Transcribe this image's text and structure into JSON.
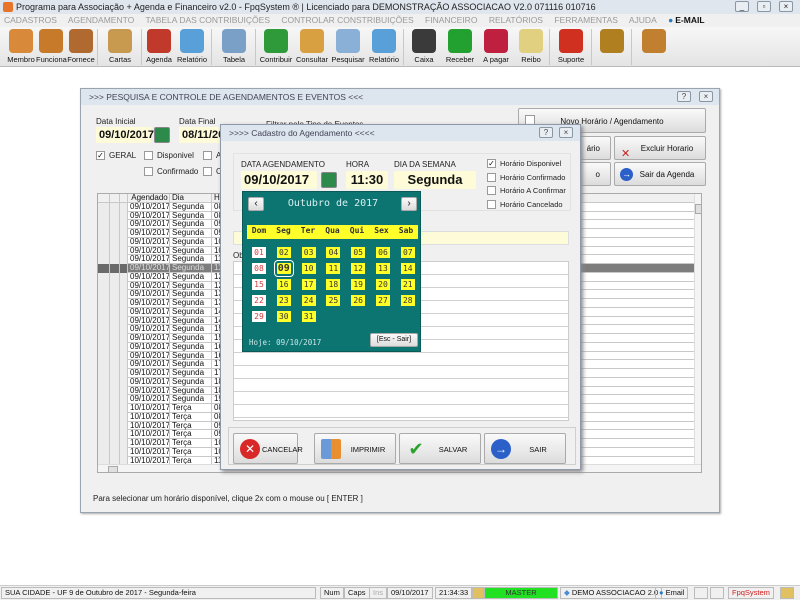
{
  "app": {
    "title": "Programa para Associação + Agenda e Financeiro v2.0 - FpqSystem ® | Licenciado para  DEMONSTRAÇÃO ASSOCIACAO V2.0 071116 010716"
  },
  "menu": [
    "CADASTROS",
    "AGENDAMENTO",
    "TABELA DAS CONTRIBUIÇÕES",
    "CONTROLAR CONSTRIBUIÇÕES",
    "FINANCEIRO",
    "RELATÓRIOS",
    "FERRAMENTAS",
    "AJUDA"
  ],
  "menu_email": "E-MAIL",
  "toolbar": [
    {
      "label": "Membro",
      "icon": "members-icon",
      "color": "#d88a3a"
    },
    {
      "label": "Funciona",
      "icon": "employee-icon",
      "color": "#c77a2a"
    },
    {
      "label": "Fornece",
      "icon": "supplier-icon",
      "color": "#b06a30"
    },
    {
      "label": "Cartas",
      "icon": "scroll-icon",
      "color": "#c89a50"
    },
    {
      "label": "Agenda",
      "icon": "calendar-icon",
      "color": "#c0392b"
    },
    {
      "label": "Relatório",
      "icon": "report-icon",
      "color": "#5aa0d8"
    },
    {
      "label": "Tabela",
      "icon": "table-icon",
      "color": "#7aa0c8"
    },
    {
      "label": "Contribuir",
      "icon": "dollar-icon",
      "color": "#2e9a3a"
    },
    {
      "label": "Consultar",
      "icon": "folder-icon",
      "color": "#d8a040"
    },
    {
      "label": "Pesquisar",
      "icon": "search-icon",
      "color": "#8ab0d8"
    },
    {
      "label": "Relatório",
      "icon": "report-icon",
      "color": "#5aa0d8"
    },
    {
      "label": "Caixa",
      "icon": "cashbook-icon",
      "color": "#3a3a3a"
    },
    {
      "label": "Receber",
      "icon": "receive-money-icon",
      "color": "#22a030"
    },
    {
      "label": "A pagar",
      "icon": "pay-money-icon",
      "color": "#c02040"
    },
    {
      "label": "Reibo",
      "icon": "receipt-icon",
      "color": "#e0d080"
    },
    {
      "label": "Suporte",
      "icon": "support-icon",
      "color": "#d03020"
    },
    {
      "label": "",
      "icon": "coins-icon",
      "color": "#b08020"
    },
    {
      "label": "",
      "icon": "exit-icon",
      "color": "#c08030"
    }
  ],
  "main": {
    "title": ">>>  PESQUISA E CONTROLE DE AGENDAMENTOS E EVENTOS  <<<",
    "data_inicial_label": "Data Inicial",
    "data_inicial": "09/10/2017",
    "data_final_label": "Data Final",
    "data_final": "08/11/2017",
    "filter_label": "Filtrar pelo Tipo de Eventos",
    "filters": [
      {
        "label": "GERAL",
        "checked": true
      },
      {
        "label": "Disponivel",
        "checked": false
      },
      {
        "label": "A",
        "checked": false
      },
      {
        "label": "Confirmado",
        "checked": false
      },
      {
        "label": "Ca",
        "checked": false
      }
    ],
    "buttons": {
      "novo": "Novo Horário / Agendamento",
      "alterar": "ário",
      "excluir": "Excluir Horario",
      "other": "o",
      "sair": "Sair da Agenda"
    },
    "grid": {
      "headers": [
        "Agendado",
        "Dia",
        "Ho"
      ],
      "selected_index": 7,
      "rows": [
        [
          "09/10/2017",
          "Segunda",
          "08:"
        ],
        [
          "09/10/2017",
          "Segunda",
          "08:"
        ],
        [
          "09/10/2017",
          "Segunda",
          "09:"
        ],
        [
          "09/10/2017",
          "Segunda",
          "09:"
        ],
        [
          "09/10/2017",
          "Segunda",
          "10:"
        ],
        [
          "09/10/2017",
          "Segunda",
          "10:"
        ],
        [
          "09/10/2017",
          "Segunda",
          "11:"
        ],
        [
          "09/10/2017",
          "Segunda",
          "11:"
        ],
        [
          "09/10/2017",
          "Segunda",
          "12:"
        ],
        [
          "09/10/2017",
          "Segunda",
          "12:"
        ],
        [
          "09/10/2017",
          "Segunda",
          "13:"
        ],
        [
          "09/10/2017",
          "Segunda",
          "13:"
        ],
        [
          "09/10/2017",
          "Segunda",
          "14:"
        ],
        [
          "09/10/2017",
          "Segunda",
          "14:"
        ],
        [
          "09/10/2017",
          "Segunda",
          "15:"
        ],
        [
          "09/10/2017",
          "Segunda",
          "15:"
        ],
        [
          "09/10/2017",
          "Segunda",
          "16:"
        ],
        [
          "09/10/2017",
          "Segunda",
          "16:"
        ],
        [
          "09/10/2017",
          "Segunda",
          "17:"
        ],
        [
          "09/10/2017",
          "Segunda",
          "17:"
        ],
        [
          "09/10/2017",
          "Segunda",
          "18:"
        ],
        [
          "09/10/2017",
          "Segunda",
          "18:"
        ],
        [
          "09/10/2017",
          "Segunda",
          "19:"
        ],
        [
          "10/10/2017",
          "Terça",
          "08:"
        ],
        [
          "10/10/2017",
          "Terça",
          "08:"
        ],
        [
          "10/10/2017",
          "Terça",
          "09:"
        ],
        [
          "10/10/2017",
          "Terça",
          "09:"
        ],
        [
          "10/10/2017",
          "Terça",
          "10:"
        ],
        [
          "10/10/2017",
          "Terça",
          "10:"
        ],
        [
          "10/10/2017",
          "Terça",
          "11:"
        ],
        [
          "10/10/2017",
          "Terça",
          "11:"
        ]
      ]
    },
    "hint": "Para selecionar um horário disponível, clique 2x com o mouse ou [ ENTER ]"
  },
  "modal": {
    "title": ">>>>   Cadastro do Agendamento   <<<<",
    "data_label": "DATA AGENDAMENTO",
    "data": "09/10/2017",
    "hora_label": "HORA",
    "hora": "11:30",
    "dia_label": "DIA DA SEMANA",
    "dia": "Segunda",
    "obs_label": "Ob",
    "status": [
      {
        "label": "Horário Disponivel",
        "checked": true
      },
      {
        "label": "Horário Confirmado",
        "checked": false
      },
      {
        "label": "Horário A Confirmar",
        "checked": false
      },
      {
        "label": "Horário Cancelado",
        "checked": false
      }
    ],
    "buttons": {
      "cancelar": "CANCELAR",
      "imprimir": "IMPRIMIR",
      "salvar": "SALVAR",
      "sair": "SAIR"
    }
  },
  "calendar": {
    "month_label": "Outubro de 2017",
    "prev": "‹",
    "next": "›",
    "weekdays": [
      "Dom",
      "Seg",
      "Ter",
      "Qua",
      "Qui",
      "Sex",
      "Sab"
    ],
    "first_weekday": 0,
    "days_in_month": 31,
    "selected_day": "09",
    "today_label": "Hoje: 09/10/2017",
    "close_label": "[Esc - Sair]",
    "day_color": "#ffff2a",
    "bg_color": "#0c7572"
  },
  "statusbar": {
    "location": "SUA CIDADE - UF  9 de Outubro de 2017 - Segunda-feira",
    "num": "Num",
    "caps": "Caps",
    "ins": "Ins",
    "date": "09/10/2017",
    "time": "21:34:33",
    "user": "MASTER",
    "db": "DEMO ASSOCIACAO 2.0",
    "email": "Email",
    "brand": "FpqSystem"
  }
}
